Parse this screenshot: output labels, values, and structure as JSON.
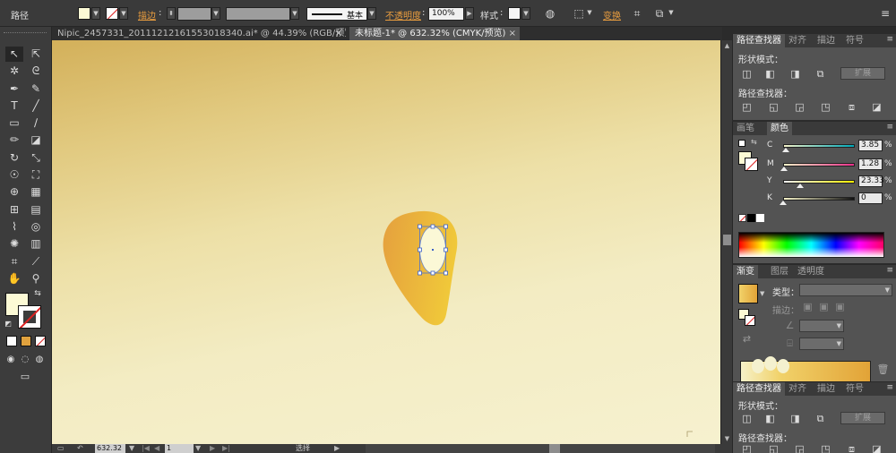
{
  "control_bar": {
    "selection_label": "路径",
    "fill_color": "#fcfad5",
    "stroke_label": "描边",
    "stroke_style_label": "基本",
    "opacity_label": "不透明度",
    "opacity_value": "100%",
    "style_label": "样式",
    "transform_label": "变换",
    "icons": [
      "recolor-icon",
      "align-grid-icon",
      "transform-icon",
      "isolate-icon"
    ]
  },
  "doc_tabs": [
    {
      "label": "Nipic_2457331_20111212161553018340.ai* @ 44.39% (RGB/预览)",
      "close": "×"
    },
    {
      "label": "未标题-1* @ 632.32% (CMYK/预览)",
      "close": "×"
    }
  ],
  "pathfinder_top": {
    "tabs": [
      "路径查找器",
      "对齐",
      "描边",
      "符号"
    ],
    "shape_modes_label": "形状模式：",
    "pathfinders_label": "路径查找器：",
    "expand_label": "扩展"
  },
  "color_panel": {
    "tabs": [
      "画笔",
      "颜色"
    ],
    "channels": [
      {
        "name": "C",
        "value": "3.85",
        "pct": "%",
        "fraction": 0.0385,
        "track": "linear-gradient(to right,#f5f2c8,#00a8b8)"
      },
      {
        "name": "M",
        "value": "1.28",
        "pct": "%",
        "fraction": 0.0128,
        "track": "linear-gradient(to right,#f5f2c8,#e8308a)"
      },
      {
        "name": "Y",
        "value": "23.33",
        "pct": "%",
        "fraction": 0.2333,
        "track": "linear-gradient(to right,#f5f5f5,#fff200)"
      },
      {
        "name": "K",
        "value": "0",
        "pct": "%",
        "fraction": 0.0,
        "track": "linear-gradient(to right,#f5f2c8,#111111)"
      }
    ]
  },
  "gradient_panel": {
    "tabs": [
      "渐变",
      "图层",
      "透明度"
    ],
    "type_label": "类型：",
    "stroke_label": "描边："
  },
  "pathfinder_bottom": {
    "tabs": [
      "路径查找器",
      "对齐",
      "描边",
      "符号"
    ],
    "shape_modes_label": "形状模式：",
    "pathfinders_label": "路径查找器：",
    "expand_label": "扩展"
  },
  "status_bar": {
    "zoom": "632.32",
    "page": "1",
    "selection_tool": "选择"
  }
}
